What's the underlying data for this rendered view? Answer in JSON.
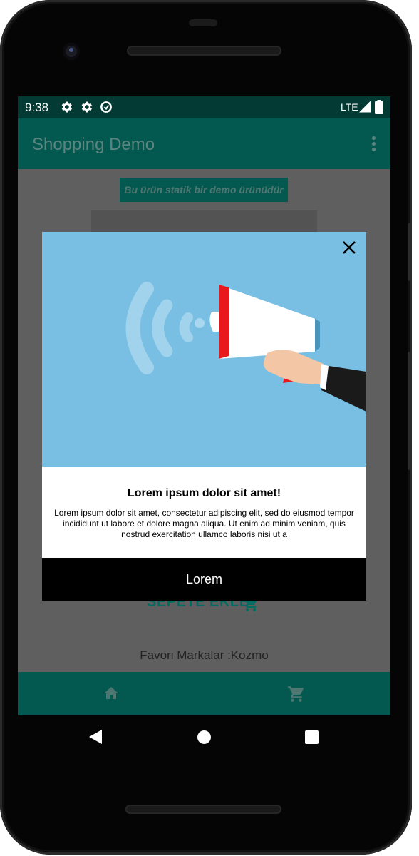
{
  "status_bar": {
    "time": "9:38",
    "network": "LTE"
  },
  "app_bar": {
    "title": "Shopping Demo"
  },
  "product": {
    "demo_notice": "Bu ürün statik bir demo ürünüdür",
    "add_to_cart_label": "SEPETE EKLE",
    "favorite_brands": "Favori Markalar :Kozmo"
  },
  "dialog": {
    "title": "Lorem ipsum dolor sit amet!",
    "body": "Lorem ipsum dolor sit amet, consectetur adipiscing elit, sed do eiusmod tempor incididunt ut labore et dolore magna aliqua. Ut enim ad minim veniam, quis nostrud exercitation ullamco laboris nisi ut a",
    "button_label": "Lorem"
  },
  "colors": {
    "primary": "#03584f",
    "status_bar": "#033a33",
    "accent_text": "#066b61",
    "hero_background": "#78bfe3"
  },
  "icons": [
    "gear-icon",
    "gear-icon",
    "data-saver-icon",
    "signal-icon",
    "battery-icon",
    "overflow-menu-icon",
    "close-icon",
    "cart-icon",
    "home-icon",
    "back-icon",
    "home-circle-icon",
    "recents-icon"
  ]
}
